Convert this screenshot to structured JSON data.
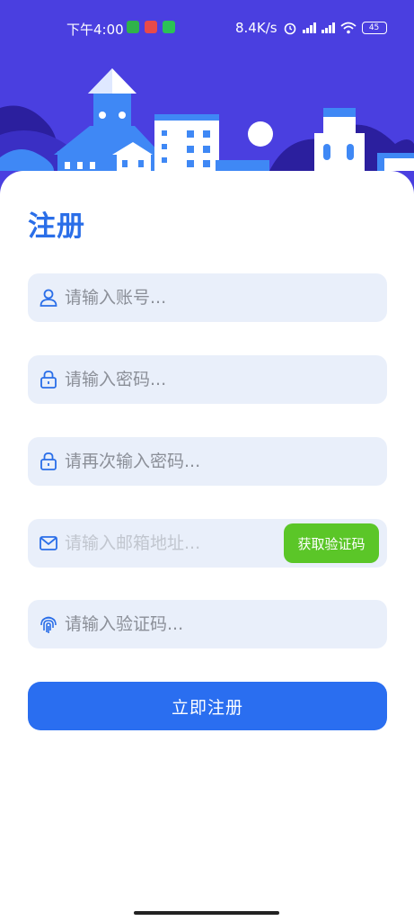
{
  "status_bar": {
    "time": "下午4:00",
    "network_speed": "8.4K/s",
    "battery": "45"
  },
  "page": {
    "title": "注册"
  },
  "form": {
    "account": {
      "placeholder": "请输入账号...",
      "icon": "user-icon"
    },
    "password": {
      "placeholder": "请输入密码...",
      "icon": "lock-icon"
    },
    "confirm_password": {
      "placeholder": "请再次输入密码...",
      "icon": "lock-icon"
    },
    "email": {
      "placeholder": "请输入邮箱地址...",
      "icon": "mail-icon",
      "code_button_label": "获取验证码"
    },
    "code": {
      "placeholder": "请输入验证码...",
      "icon": "fingerprint-icon"
    },
    "submit_label": "立即注册"
  },
  "colors": {
    "header_bg": "#4a3fe0",
    "primary": "#2a6ef0",
    "title": "#2a6ee8",
    "input_bg": "#e9effa",
    "code_button": "#5bc628"
  }
}
